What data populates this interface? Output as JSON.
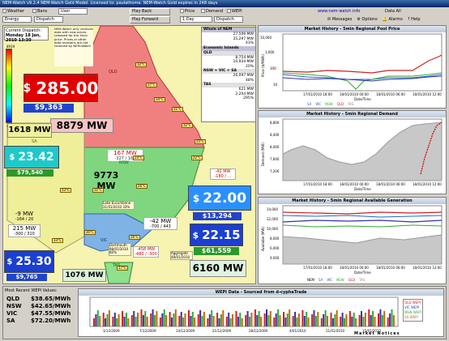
{
  "window": {
    "title": "NEM-Watch v9.2.4  NEM-Watch Gold Model.   Licensed to: paulathome.   NEM-Watch Gold expires in 248 days"
  },
  "toolbar": {
    "weather": "Weather",
    "bans": "Bans",
    "user": "User",
    "energy": "Energy",
    "dispatch": "Dispatch",
    "play_back": "Play Back",
    "play_forward": "Play Forward",
    "price": "Price",
    "demand": "Demand",
    "wepi": "WEPI",
    "day": "1 Day",
    "dispatch2": "Dispatch",
    "url": "www.nem-watch.info",
    "data": "Data",
    "all": "All",
    "messages": "Messages",
    "options": "Options",
    "alarms": "Alarms",
    "help": "Help"
  },
  "dispatch": {
    "label": "Current Dispatch:",
    "time": "Monday 18 Jan, 2010 13:30"
  },
  "scale": {
    "max": "8919",
    "min": "4006"
  },
  "notice": "NEM-Watch only receives data with new prices released for the 5min price. Prices or other data revisions are not received by NEM-Watch",
  "regions": {
    "qld": {
      "price": "285.00",
      "wepi": "$9,363",
      "demand": "8879 MW",
      "tag": "QLD"
    },
    "nsw": {
      "price": "",
      "demand": "9773 MW",
      "tag": "NSW"
    },
    "sa": {
      "price": "23.42",
      "wepi": "$79,540",
      "demand": "1618 MW",
      "tag": "SA"
    },
    "vic": {
      "price": "22.15",
      "wepi": "$61,559",
      "demand": "6160 MW",
      "tag": "VIC"
    },
    "tas": {
      "price": "25.30",
      "wepi": "$9,765",
      "demand": "1076 MW",
      "tag": "TAS"
    },
    "snowy": {
      "price": "22.00",
      "wepi": "$13,294"
    }
  },
  "currency": "$",
  "flows": {
    "qni": {
      "value": "167 MW",
      "limits": "-327 / 167"
    },
    "heywood": {
      "value": "-9 MW",
      "limits": "-164 / 20"
    },
    "murraylink": {
      "value": "215 MW",
      "limits": "-300 / 310"
    },
    "vic_nsw": {
      "value": "-42 MW",
      "limits": "-700 / 443"
    },
    "terranora": {
      "value": "-42 MW",
      "limits": "-180 / ..."
    },
    "basslink": {
      "value": "-458 MW",
      "limits": "-480 / -300"
    }
  },
  "temps": [
    "32°C",
    "37°C",
    "34°C",
    "31°C",
    "32°C",
    "25°C",
    "22°C",
    "24°C",
    "26°C",
    "31°C",
    "33°C",
    "30°C",
    "33°C",
    "26°C",
    "17°C"
  ],
  "cities": {
    "perth": "",
    "melb": "",
    "adelaide": "Adelaide 47.5°C",
    "lake": "Lake Eucumbene 31/01/2010 33%",
    "dartmouth": "Dartmouth 98/01/2010 80%",
    "hume": "Hume 08/01/2010 96%",
    "tas_storage": "Aggregate 48/01/2010"
  },
  "nem_table": {
    "header": "Whole of NEM",
    "rows": [
      [
        "",
        "27,506 MW"
      ],
      [
        "",
        "35,297 MW"
      ],
      [
        "",
        "43%"
      ]
    ],
    "econ": "Economic Islands",
    "qld": {
      "label": "QLD",
      "rows": [
        [
          "",
          "8,754 MW"
        ],
        [
          "",
          "10,934 MW"
        ],
        [
          "",
          "20%"
        ]
      ]
    },
    "nsw": {
      "label": "NSW + VIC + SA",
      "rows": [
        [
          "",
          "26,097 MW"
        ],
        [
          "",
          "48%"
        ]
      ]
    },
    "tas": {
      "label": "TAS",
      "rows": [
        [
          "",
          "621 MW"
        ],
        [
          "",
          "2,204 MW"
        ],
        [
          "",
          "295%"
        ]
      ]
    }
  },
  "price_chart": {
    "title": "Market History - 5min Regional Pool Price",
    "ylabel": "Price ($/MWh)",
    "xlabel": "Date/Time",
    "yticks": [
      "10,000",
      "1,000",
      "100",
      "10"
    ],
    "xticks": [
      "17/01/2010 18:00",
      "18/01/2010 00:00",
      "18/01/2010 06:00",
      "18/01/2010 12:00"
    ],
    "legend": [
      "SA",
      "VIC",
      "NSW",
      "QLD",
      "TAS"
    ]
  },
  "demand_chart": {
    "title": "Market History - 5min Regional Demand",
    "ylabel": "Demand (MW)",
    "xlabel": "Date/Time",
    "yticks": [
      "8,800",
      "8,600",
      "8,400",
      "8,200",
      "8,000",
      "7,800",
      "7,600",
      "7,400",
      "7,200",
      "7,000"
    ],
    "xticks": [
      "17/01/2010 18:00",
      "18/01/2010 00:00",
      "18/01/2010 06:00",
      "18/01/2010 12:00"
    ]
  },
  "gen_chart": {
    "title": "Market History - 5min Regional Available Generation",
    "ylabel": "Available (MW)",
    "xlabel": "Date/Time",
    "yticks": [
      "14,000",
      "12,000",
      "10,000",
      "8,000",
      "6,000",
      "4,000",
      "2,000"
    ],
    "xticks": [
      "17/01/2010 18:00",
      "18/01/2010 00:00",
      "18/01/2010 06:00",
      "18/01/2010 12:00"
    ],
    "legend": [
      "NEM",
      "SA",
      "VIC",
      "NSW",
      "QLD",
      "TAS"
    ]
  },
  "wepi": {
    "label": "Most Recent WEPI Values:",
    "rows": [
      [
        "QLD",
        "$38.65/MWh"
      ],
      [
        "NSW",
        "$42.65/MWh"
      ],
      [
        "VIC",
        "$47.55/MWh"
      ],
      [
        "SA",
        "$72.20/MWh"
      ]
    ],
    "chart_title": "WEPI Data - Sourced from d-cyphaTrade",
    "xticks": [
      "3/12/2009",
      "7/12/2009",
      "14/12/2009",
      "21/12/2009",
      "28/12/2009",
      "4/01/2010",
      "11/01/2010",
      "15/01/2010"
    ],
    "legend": [
      "QLD WEPI",
      "VIC WEPI",
      "NSW WEPI",
      "SA WEPI"
    ],
    "market_notices": "Market Notices"
  },
  "colors": {
    "qld": "#cc2222",
    "nsw": "#33aa33",
    "sa": "#2266cc",
    "vic": "#3333aa",
    "tas": "#888888",
    "map_qld": "#f08080",
    "map_nsw": "#7fd67f",
    "map_vic": "#7fb2e5",
    "map_sa": "#e5e57f"
  }
}
